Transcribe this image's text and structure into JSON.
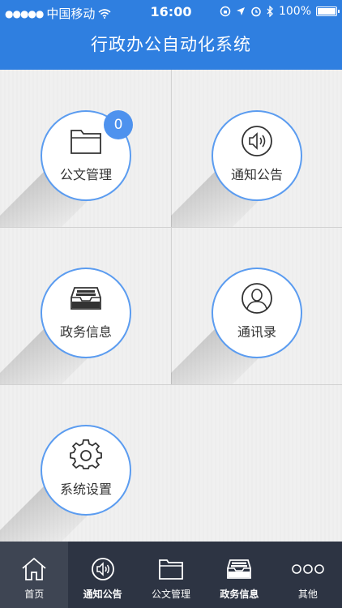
{
  "status_bar": {
    "signal": "●●●●●",
    "carrier": "中国移动",
    "time": "16:00",
    "battery_pct": "100%",
    "battery_level": 1.0
  },
  "header": {
    "title": "行政办公自动化系统"
  },
  "tiles": [
    {
      "label": "公文管理",
      "icon": "folder-icon",
      "badge": "0"
    },
    {
      "label": "通知公告",
      "icon": "speaker-icon"
    },
    {
      "label": "政务信息",
      "icon": "inbox-tray-icon"
    },
    {
      "label": "通讯录",
      "icon": "contact-person-icon"
    },
    {
      "label": "系统设置",
      "icon": "gear-icon"
    }
  ],
  "tabbar": {
    "items": [
      {
        "label": "首页",
        "icon": "home-icon",
        "active": true
      },
      {
        "label": "通知公告",
        "icon": "speaker-icon",
        "active": false
      },
      {
        "label": "公文管理",
        "icon": "folder-icon",
        "active": false
      },
      {
        "label": "政务信息",
        "icon": "inbox-tray-icon",
        "active": false
      },
      {
        "label": "其他",
        "icon": "more-dots-icon",
        "active": false
      }
    ]
  },
  "colors": {
    "primary": "#2f7fe0",
    "tile_border": "#5b9cf0",
    "badge": "#4e92ee",
    "tabbar": "#2d3443",
    "tab_active": "#3e4553"
  }
}
